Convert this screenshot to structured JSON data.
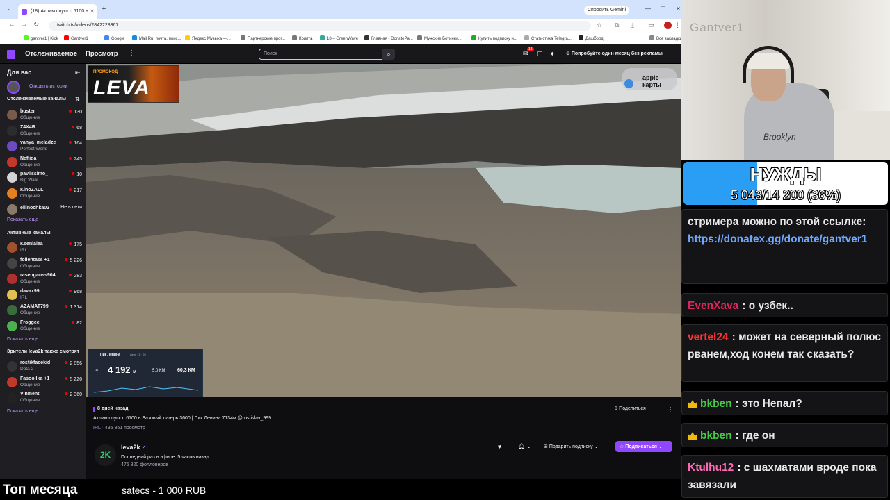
{
  "browser": {
    "tab_title": "(18) Аклим спуск с 6100 в",
    "gemini": "Спросить Gemini",
    "url": "twitch.tv/videos/2842228367",
    "bookmarks": [
      "gantver1 | Kick",
      "Gantver1",
      "Google",
      "Mail.Ru: почта, поис...",
      "Яндекс Музыка —...",
      "Партнерские прог...",
      "Крипта",
      "18 – GreenWave",
      "Главная - DonatePa...",
      "Мужские Ботинки...",
      "Купить подписку н...",
      "Статистика Telegra...",
      "Дашборд",
      "Все закладки"
    ]
  },
  "twitch_nav": {
    "following": "Отслеживаемое",
    "browse": "Просмотр",
    "search_placeholder": "Поиск",
    "notif_count": "18",
    "promo": "Попробуйте один месяц без рекламы"
  },
  "sidebar": {
    "for_you": "Для вас",
    "stories": "Открыть истории",
    "followed_title": "Отслеживаемые каналы",
    "followed": [
      {
        "name": "buster",
        "category": "Общение",
        "viewers": "130",
        "color": "#7a5a4a"
      },
      {
        "name": "Z4X4R",
        "category": "Общение",
        "viewers": "68",
        "color": "#2c2c2c"
      },
      {
        "name": "vanya_meladze",
        "category": "Perfect World",
        "viewers": "164",
        "color": "#6b4bbf"
      },
      {
        "name": "Neflida",
        "category": "Общение",
        "viewers": "245",
        "color": "#c0392b"
      },
      {
        "name": "pavlissimo_",
        "category": "Big Walk",
        "viewers": "10",
        "color": "#d4d4d4"
      },
      {
        "name": "KinoZALL",
        "category": "Общение",
        "viewers": "217",
        "color": "#e67e22"
      },
      {
        "name": "ellinochka02",
        "category": "",
        "viewers": "Не в сети",
        "color": "#8a7a6a"
      }
    ],
    "show_more": "Показать еще",
    "active_title": "Активные каналы",
    "active": [
      {
        "name": "Ksenialea",
        "category": "IRL",
        "viewers": "175",
        "color": "#a0522d"
      },
      {
        "name": "follentass +1",
        "category": "Общение",
        "viewers": "5 226",
        "color": "#444"
      },
      {
        "name": "rasenganss904",
        "category": "Общение",
        "viewers": "283",
        "color": "#b03030"
      },
      {
        "name": "davax99",
        "category": "IRL",
        "viewers": "968",
        "color": "#e0c050"
      },
      {
        "name": "AZAMAT799",
        "category": "Общение",
        "viewers": "1 314",
        "color": "#3a6b3a"
      },
      {
        "name": "Froggee",
        "category": "Общение",
        "viewers": "82",
        "color": "#4caf50"
      }
    ],
    "also_title": "Зрители leva2k также смотрят",
    "also": [
      {
        "name": "rostikfacekid",
        "category": "Dota 2",
        "viewers": "2 856",
        "color": "#333"
      },
      {
        "name": "Fasoollka +1",
        "category": "Общение",
        "viewers": "5 226",
        "color": "#c0392b"
      },
      {
        "name": "Vinment",
        "category": "Общение",
        "viewers": "2 360",
        "color": "#222"
      }
    ]
  },
  "video": {
    "promo_tag": "ПРОМОКОД",
    "promo_name": "LEVA",
    "apple_line1": "apple",
    "apple_line2": "карты",
    "overlay_title": "Пик Ленина",
    "overlay_date": "День 16 · 20",
    "overlay_alt": "4 192",
    "overlay_unit": "м",
    "overlay_km1": "5,0 КМ",
    "overlay_km2": "60,3 КМ",
    "overlay_small": "17."
  },
  "info": {
    "date": "8 дней назад",
    "title": "Аклим спуск с 6100 в Базовый лагерь 3600 | Пик Ленина 7134м @rostislav_999",
    "category": "IRL",
    "views": " · 435 861 просмотр",
    "share": "Поделиться",
    "channel": "leva2k",
    "logo": "2K",
    "last_live": "Последний раз в эфире: 5 часов назад",
    "followers": "475 820 фолловеров",
    "gift": "Подарить подписку",
    "subscribe": "Подписаться"
  },
  "webcam": {
    "wall_logo": "Gantver1",
    "hoodie_text": "Brooklyn"
  },
  "goal": {
    "title": "НУЖДЫ",
    "amount": "5 043/14 200 (36%)",
    "progress": 0.36
  },
  "chat": [
    {
      "user": "",
      "user_color": "#e8e8ea",
      "text": "стримера можно по этой ссылке:",
      "link": "https://donatex.gg/donate/gantver1",
      "crown": false
    },
    {
      "user": "EvenXava",
      "user_color": "#e0245e",
      "text": ": о узбек..",
      "crown": false
    },
    {
      "user": "vertel24",
      "user_color": "#ff3333",
      "text": ": может на северный полюс рванем,ход конем так сказать?",
      "crown": false
    },
    {
      "user": "bkben",
      "user_color": "#44cc44",
      "text": ": это Непал?",
      "crown": true
    },
    {
      "user": "bkben",
      "user_color": "#44cc44",
      "text": ": где он",
      "crown": true
    },
    {
      "user": "Ktulhu12",
      "user_color": "#ff69b4",
      "text": ": с шахматами вроде пока завязали",
      "crown": false
    }
  ],
  "ticker": {
    "title": "Топ месяца",
    "item": "satecs - 1 000 RUB"
  }
}
